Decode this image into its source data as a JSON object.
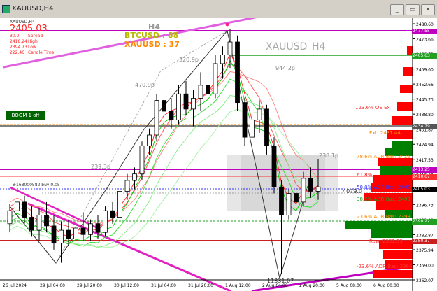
{
  "window": {
    "title": "XAUUSD,H4",
    "minimize_label": "_",
    "restore_label": "▭",
    "close_label": "✕"
  },
  "chart": {
    "symbol_short": "XAUUSD,H4",
    "watermark_symbol": "XAUUSD",
    "watermark_tf": "H4",
    "tf_label": "H4",
    "btc_label": "BTCUSD : 88",
    "xau_label": "XAUUSD : 37",
    "price_big": "2405.03",
    "info_rows": [
      {
        "value": "30.0",
        "label": "Spread"
      },
      {
        "value": "2418.24",
        "label": "High"
      },
      {
        "value": "2394.73",
        "label": "Low"
      },
      {
        "value": "222.46",
        "label": "Candle Time"
      }
    ],
    "boom_label": "BOOM  1 off",
    "order_label": "#168000582 buy 0.05",
    "range_label": "4079.0",
    "swing_labels": [
      "470.9p",
      "320.9p",
      "944.2p",
      "239.3p",
      "238.1p"
    ],
    "swing_low_label": "11331.07",
    "fib_labels": [
      {
        "text": "123.6% OE Ex",
        "color": "#ff3030"
      },
      {
        "text": "Ext: 2431.44",
        "color": "#ff8800"
      },
      {
        "text": "78.6% ADR Bas: 2426",
        "color": "#ff8800"
      },
      {
        "text": "61.8%",
        "color": "#ff0000"
      },
      {
        "text": "50.0% ADR Bas: 2406",
        "color": "#3030ff"
      },
      {
        "text": "38.2% ADR Bas: 2400",
        "color": "#22a022"
      },
      {
        "text": "23.6% ADR Bas: 2393",
        "color": "#ff8800"
      },
      {
        "text": "Raw: 2381.53",
        "color": "#ff3030"
      },
      {
        "text": "-23.6% ADR Bas: 2366",
        "color": "#ff3030"
      }
    ],
    "price_axis": [
      "2480.60",
      "2473.66",
      "2466.73",
      "2459.60",
      "2452.66",
      "2445.73",
      "2438.80",
      "2431.87",
      "2424.94",
      "2417.53",
      "2410.60",
      "2403.66",
      "2396.73",
      "2389.80",
      "2382.87",
      "2375.94",
      "2369.00",
      "2362.07"
    ],
    "price_tags": [
      {
        "text": "2477.55",
        "bg": "#c000c0"
      },
      {
        "text": "2465.63",
        "bg": "#22a022"
      },
      {
        "text": "2434.79",
        "bg": "#555555"
      },
      {
        "text": "2413.25",
        "bg": "#c000c0"
      },
      {
        "text": "2410.67",
        "bg": "#ff3030"
      },
      {
        "text": "2405.03",
        "bg": "#000000"
      },
      {
        "text": "2390.22",
        "bg": "#22a022"
      },
      {
        "text": "2380.37",
        "bg": "#cc2020"
      }
    ],
    "time_axis": [
      "26 Jul 2024",
      "29 Jul 04:00",
      "29 Jul 20:00",
      "30 Jul 12:00",
      "31 Jul 04:00",
      "31 Jul 20:00",
      "1 Aug 12:00",
      "2 Aug 04:00",
      "2 Aug 20:00",
      "5 Aug 08:00",
      "6 Aug 00:00"
    ],
    "colors": {
      "bull": "#00d000",
      "bear": "#000000",
      "magenta": "#c000c0",
      "volume_red": "#ff0000",
      "volume_green": "#008000"
    }
  },
  "chart_data": {
    "type": "candlestick",
    "title": "XAUUSD,H4",
    "ylim": [
      2362.07,
      2483.0
    ],
    "candles": [
      {
        "o": 2388,
        "h": 2397,
        "l": 2384,
        "c": 2394
      },
      {
        "o": 2394,
        "h": 2402,
        "l": 2390,
        "c": 2398
      },
      {
        "o": 2398,
        "h": 2401,
        "l": 2388,
        "c": 2391
      },
      {
        "o": 2391,
        "h": 2396,
        "l": 2382,
        "c": 2385
      },
      {
        "o": 2385,
        "h": 2395,
        "l": 2380,
        "c": 2392
      },
      {
        "o": 2392,
        "h": 2398,
        "l": 2384,
        "c": 2387
      },
      {
        "o": 2387,
        "h": 2392,
        "l": 2376,
        "c": 2379
      },
      {
        "o": 2379,
        "h": 2389,
        "l": 2370,
        "c": 2385
      },
      {
        "o": 2385,
        "h": 2390,
        "l": 2378,
        "c": 2381
      },
      {
        "o": 2381,
        "h": 2388,
        "l": 2377,
        "c": 2386
      },
      {
        "o": 2386,
        "h": 2393,
        "l": 2380,
        "c": 2383
      },
      {
        "o": 2383,
        "h": 2390,
        "l": 2380,
        "c": 2388
      },
      {
        "o": 2388,
        "h": 2392,
        "l": 2381,
        "c": 2384
      },
      {
        "o": 2384,
        "h": 2396,
        "l": 2382,
        "c": 2394
      },
      {
        "o": 2394,
        "h": 2398,
        "l": 2388,
        "c": 2391
      },
      {
        "o": 2391,
        "h": 2405,
        "l": 2390,
        "c": 2403
      },
      {
        "o": 2403,
        "h": 2411,
        "l": 2399,
        "c": 2408
      },
      {
        "o": 2408,
        "h": 2414,
        "l": 2404,
        "c": 2411
      },
      {
        "o": 2411,
        "h": 2426,
        "l": 2408,
        "c": 2424
      },
      {
        "o": 2424,
        "h": 2432,
        "l": 2420,
        "c": 2429
      },
      {
        "o": 2429,
        "h": 2448,
        "l": 2426,
        "c": 2445
      },
      {
        "o": 2445,
        "h": 2450,
        "l": 2436,
        "c": 2440
      },
      {
        "o": 2440,
        "h": 2446,
        "l": 2432,
        "c": 2436
      },
      {
        "o": 2436,
        "h": 2452,
        "l": 2434,
        "c": 2448
      },
      {
        "o": 2448,
        "h": 2454,
        "l": 2438,
        "c": 2441
      },
      {
        "o": 2441,
        "h": 2450,
        "l": 2433,
        "c": 2446
      },
      {
        "o": 2446,
        "h": 2458,
        "l": 2440,
        "c": 2452
      },
      {
        "o": 2452,
        "h": 2462,
        "l": 2444,
        "c": 2448
      },
      {
        "o": 2448,
        "h": 2466,
        "l": 2446,
        "c": 2462
      },
      {
        "o": 2462,
        "h": 2470,
        "l": 2455,
        "c": 2466
      },
      {
        "o": 2466,
        "h": 2478,
        "l": 2460,
        "c": 2472
      },
      {
        "o": 2472,
        "h": 2475,
        "l": 2440,
        "c": 2444
      },
      {
        "o": 2444,
        "h": 2446,
        "l": 2424,
        "c": 2428
      },
      {
        "o": 2428,
        "h": 2440,
        "l": 2424,
        "c": 2436
      },
      {
        "o": 2436,
        "h": 2445,
        "l": 2430,
        "c": 2441
      },
      {
        "o": 2441,
        "h": 2443,
        "l": 2420,
        "c": 2424
      },
      {
        "o": 2424,
        "h": 2428,
        "l": 2402,
        "c": 2405
      },
      {
        "o": 2405,
        "h": 2408,
        "l": 2365,
        "c": 2392
      },
      {
        "o": 2392,
        "h": 2404,
        "l": 2390,
        "c": 2402
      },
      {
        "o": 2402,
        "h": 2408,
        "l": 2396,
        "c": 2398
      },
      {
        "o": 2398,
        "h": 2412,
        "l": 2396,
        "c": 2409
      },
      {
        "o": 2409,
        "h": 2414,
        "l": 2400,
        "c": 2403
      },
      {
        "o": 2403,
        "h": 2418,
        "l": 2399,
        "c": 2405
      }
    ]
  }
}
